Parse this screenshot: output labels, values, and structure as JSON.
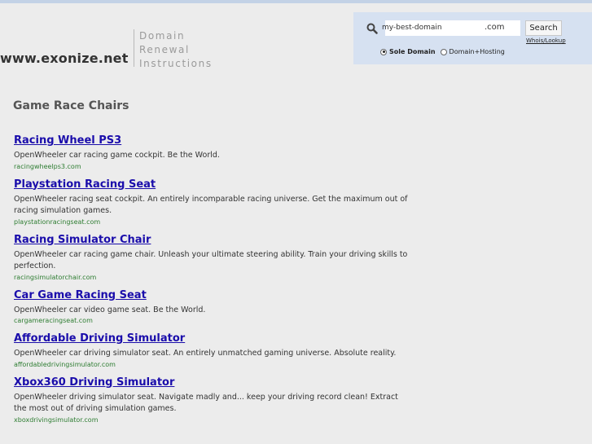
{
  "header": {
    "site_title": "www.exonize.net",
    "tagline": [
      "Domain",
      "Renewal",
      "Instructions"
    ]
  },
  "search": {
    "input_value": "my-best-domain",
    "tld": ".com",
    "button_label": "Search",
    "whois_link": "Whois/Lookup",
    "radio_options": [
      {
        "label": "Sole Domain",
        "checked": true
      },
      {
        "label": "Domain+Hosting",
        "checked": false
      }
    ]
  },
  "main": {
    "section_title": "Game Race Chairs",
    "results": [
      {
        "title": "Racing Wheel PS3",
        "desc": "OpenWheeler car racing game cockpit. Be the World.",
        "url": "racingwheelps3.com"
      },
      {
        "title": "Playstation Racing Seat",
        "desc": "OpenWheeler racing seat cockpit. An entirely incomparable racing universe. Get the maximum out of racing simulation games.",
        "url": "playstationracingseat.com"
      },
      {
        "title": "Racing Simulator Chair",
        "desc": "OpenWheeler car racing game chair. Unleash your ultimate steering ability. Train your driving skills to perfection.",
        "url": "racingsimulatorchair.com"
      },
      {
        "title": "Car Game Racing Seat",
        "desc": "OpenWheeler car video game seat. Be the World.",
        "url": "cargameracingseat.com"
      },
      {
        "title": "Affordable Driving Simulator",
        "desc": "OpenWheeler car driving simulator seat. An entirely unmatched gaming universe. Absolute reality.",
        "url": "affordabledrivingsimulator.com"
      },
      {
        "title": "Xbox360 Driving Simulator",
        "desc": "OpenWheeler driving simulator seat. Navigate madly and... keep your driving record clean! Extract the most out of driving simulation games.",
        "url": "xboxdrivingsimulator.com"
      }
    ]
  }
}
